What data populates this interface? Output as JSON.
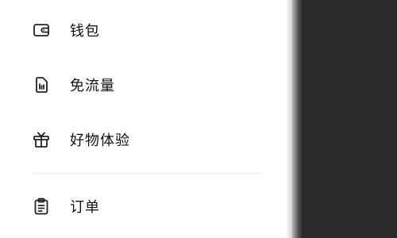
{
  "menu": {
    "items": [
      {
        "label": "钱包",
        "icon": "wallet-icon"
      },
      {
        "label": "免流量",
        "icon": "sim-card-icon"
      },
      {
        "label": "好物体验",
        "icon": "gift-icon"
      },
      {
        "label": "订单",
        "icon": "clipboard-icon"
      }
    ]
  },
  "colors": {
    "drawer_bg": "#ffffff",
    "overlay_bg": "#2b2b2b",
    "text": "#111111",
    "icon_stroke": "#222222",
    "divider": "#ececec"
  }
}
